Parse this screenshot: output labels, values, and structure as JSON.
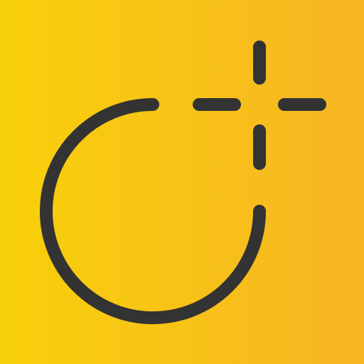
{
  "icon": {
    "name": "add-circle-crosshair-icon",
    "background_gradient": [
      "#F8D00A",
      "#F7B524"
    ],
    "stroke_color": "#333333"
  }
}
